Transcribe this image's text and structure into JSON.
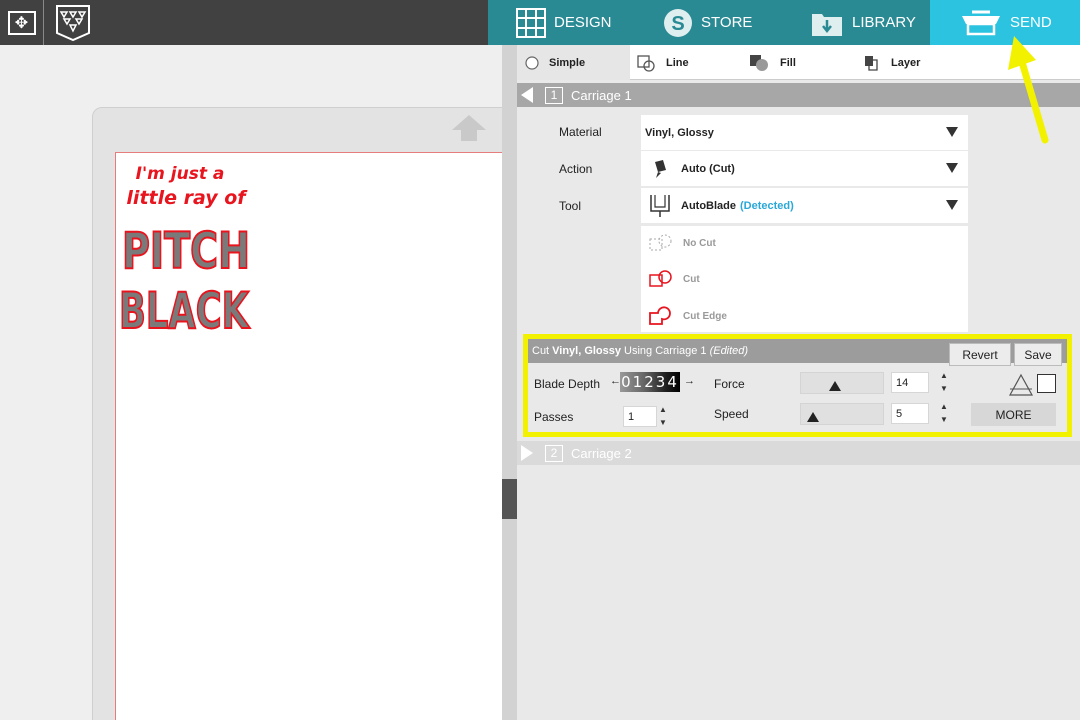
{
  "nav_tabs": [
    {
      "label": "DESIGN",
      "icon": "grid-icon"
    },
    {
      "label": "STORE",
      "icon": "store-s-icon"
    },
    {
      "label": "LIBRARY",
      "icon": "download-icon"
    },
    {
      "label": "SEND",
      "icon": "cutter-icon",
      "active": true
    }
  ],
  "modes": [
    {
      "label": "Simple"
    },
    {
      "label": "Line"
    },
    {
      "label": "Fill"
    },
    {
      "label": "Layer"
    }
  ],
  "carriage1": {
    "num": "1",
    "label": "Carriage 1"
  },
  "carriage2": {
    "num": "2",
    "label": "Carriage 2"
  },
  "material": {
    "label": "Material",
    "value": "Vinyl, Glossy"
  },
  "action": {
    "label": "Action",
    "value": "Auto (Cut)"
  },
  "tool": {
    "label": "Tool",
    "value": "AutoBlade",
    "detected": "(Detected)"
  },
  "tool_options": [
    {
      "label": "No Cut"
    },
    {
      "label": "Cut"
    },
    {
      "label": "Cut Edge"
    }
  ],
  "settings": {
    "header_prefix": "Cut",
    "header_material": "Vinyl, Glossy",
    "header_using": "Using Carriage 1",
    "header_state": "(Edited)",
    "revert": "Revert",
    "save": "Save",
    "blade_depth_label": "Blade Depth",
    "blade_depth_digits": "01234",
    "force_label": "Force",
    "force_value": "14",
    "passes_label": "Passes",
    "passes_value": "1",
    "speed_label": "Speed",
    "speed_value": "5",
    "more": "MORE"
  },
  "design_text": {
    "line1": "I'm just a",
    "line2": "little ray of",
    "line3": "PITCH",
    "line4": "BLACK"
  },
  "colors": {
    "nav_bg": "#2a8a94",
    "send_active": "#2bc3e0",
    "highlight": "#f2f200",
    "design_red": "#e8141e",
    "design_grey": "#7a7a7a"
  }
}
